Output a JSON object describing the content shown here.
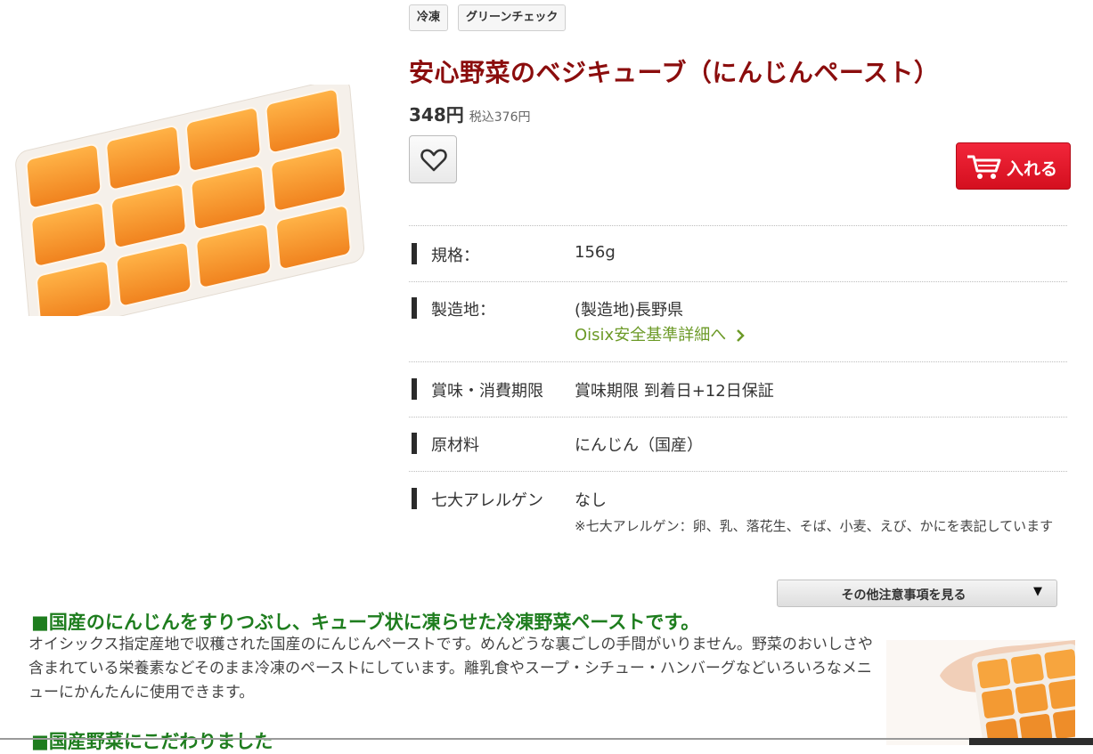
{
  "tags": {
    "frozen": "冷凍",
    "green_check": "グリーンチェック"
  },
  "product": {
    "title": "安心野菜のベジキューブ（にんじんペースト）",
    "price": "348円",
    "price_tax": "税込376円",
    "image_icon": "carrot-cube-tray-image"
  },
  "favorite": {
    "icon": "heart-icon"
  },
  "cart": {
    "label": "入れる",
    "icon": "cart-icon",
    "color": "#e8101f"
  },
  "specs": {
    "size": {
      "label": "規格：",
      "value": "156g"
    },
    "origin": {
      "label": "製造地：",
      "value": "(製造地)長野県",
      "link": "Oisix安全基準詳細へ"
    },
    "expiry": {
      "label": "賞味・消費期限",
      "value": "賞味期限 到着日+12日保証"
    },
    "ingredients": {
      "label": "原材料",
      "value": "にんじん（国産）"
    },
    "allergens": {
      "label": "七大アレルゲン",
      "value": "なし",
      "note": "※七大アレルゲン：卵、乳、落花生、そば、小麦、えび、かにを表記しています"
    }
  },
  "more_notes": {
    "label": "その他注意事項を見る",
    "arrow": "▼"
  },
  "description": {
    "heading": "■国産のにんじんをすりつぶし、キューブ状に凍らせた冷凍野菜ペーストです。",
    "body": "オイシックス指定産地で収穫された国産のにんじんペーストです。めんどうな裏ごしの手間がいりません。野菜のおいしさや含まれている栄養素などそのまま冷凍のペーストにしています。離乳食やスープ・シチュー・ハンバーグなどいろいろなメニューにかんたんに使用できます。",
    "heading2": "■国産野菜にこだわりました"
  },
  "colors": {
    "title": "#8b0d0d",
    "heading": "#1e7d1e",
    "link": "#6c9a27"
  }
}
